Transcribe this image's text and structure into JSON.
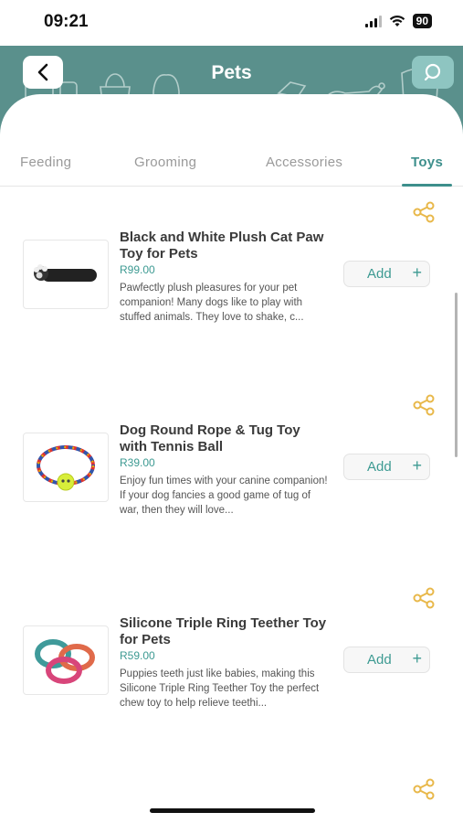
{
  "status": {
    "time": "09:21",
    "battery": "90"
  },
  "header": {
    "title": "Pets"
  },
  "tabs": [
    {
      "label": "Feeding",
      "active": false
    },
    {
      "label": "Grooming",
      "active": false
    },
    {
      "label": "Accessories",
      "active": false
    },
    {
      "label": "Toys",
      "active": true
    }
  ],
  "colors": {
    "accent": "#3d8f8c",
    "banner": "#5a908c",
    "share": "#e8b84a"
  },
  "products": [
    {
      "name": "Black and White Plush Cat Paw Toy for Pets",
      "price": "R99.00",
      "description": "Pawfectly plush pleasures for your pet companion! Many dogs like to play with stuffed animals. They love to shake, c...",
      "add_label": "Add",
      "plus": "+",
      "image": "plush-paw-toy"
    },
    {
      "name": "Dog Round Rope & Tug Toy with Tennis Ball",
      "price": "R39.00",
      "description": "Enjoy fun times with your canine companion! If your dog fancies a good game of tug of war, then they will love...",
      "add_label": "Add",
      "plus": "+",
      "image": "rope-ring-toy"
    },
    {
      "name": "Silicone Triple Ring Teether Toy for Pets",
      "price": "R59.00",
      "description": "Puppies teeth just like babies, making this Silicone Triple Ring Teether Toy the perfect chew toy to help relieve teethi...",
      "add_label": "Add",
      "plus": "+",
      "image": "triple-ring-teether"
    }
  ]
}
